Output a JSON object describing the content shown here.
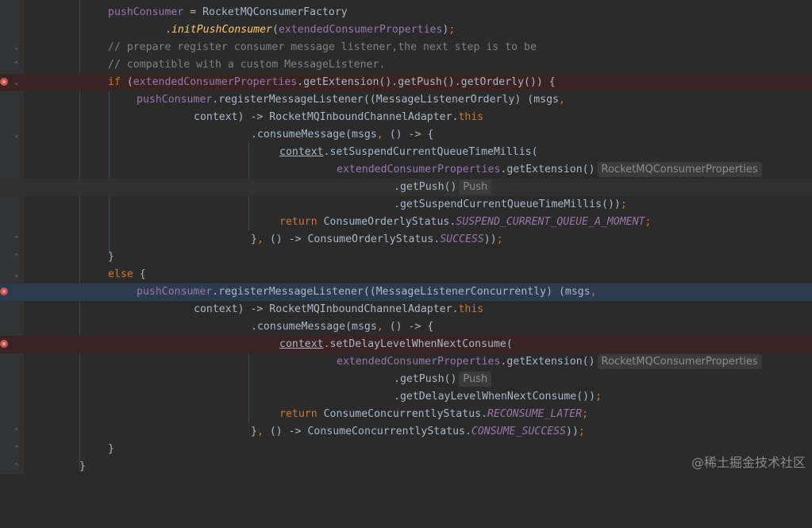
{
  "lines": [
    {
      "t": "pushConsumer = RocketMQConsumerFactory"
    },
    {
      "t": ".initPushConsumer(extendedConsumerProperties);"
    },
    {
      "t": "// prepare register consumer message listener,the next step is to be"
    },
    {
      "t": "// compatible with a custom MessageListener."
    },
    {
      "t": "if (extendedConsumerProperties.getExtension().getPush().getOrderly()) {"
    },
    {
      "t": "pushConsumer.registerMessageListener((MessageListenerOrderly) (msgs,"
    },
    {
      "t": "context) -> RocketMQInboundChannelAdapter.this"
    },
    {
      "t": ".consumeMessage(msgs, () -> {"
    },
    {
      "t": "context.setSuspendCurrentQueueTimeMillis("
    },
    {
      "t": "extendedConsumerProperties.getExtension()"
    },
    {
      "t": ".getPush()"
    },
    {
      "t": ".getSuspendCurrentQueueTimeMillis());"
    },
    {
      "t": "return ConsumeOrderlyStatus.SUSPEND_CURRENT_QUEUE_A_MOMENT;"
    },
    {
      "t": "}, () -> ConsumeOrderlyStatus.SUCCESS));"
    },
    {
      "t": "}"
    },
    {
      "t": "else {"
    },
    {
      "t": "pushConsumer.registerMessageListener((MessageListenerConcurrently) (msgs,"
    },
    {
      "t": "context) -> RocketMQInboundChannelAdapter.this"
    },
    {
      "t": ".consumeMessage(msgs, () -> {"
    },
    {
      "t": "context.setDelayLevelWhenNextConsume("
    },
    {
      "t": "extendedConsumerProperties.getExtension()"
    },
    {
      "t": ".getPush()"
    },
    {
      "t": ".getDelayLevelWhenNextConsume());"
    },
    {
      "t": "return ConsumeConcurrentlyStatus.RECONSUME_LATER;"
    },
    {
      "t": "}, () -> ConsumeConcurrentlyStatus.CONSUME_SUCCESS));"
    },
    {
      "t": "}"
    },
    {
      "t": "}"
    }
  ],
  "hints": {
    "props_type": "RocketMQConsumerProperties",
    "push_type": "Push"
  },
  "watermark": "@稀土掘金技术社区",
  "colors": {
    "background": "#2b2b2b",
    "keyword": "#cc7832",
    "field": "#9876aa",
    "comment": "#808080",
    "breakpoint": "#c75450"
  }
}
